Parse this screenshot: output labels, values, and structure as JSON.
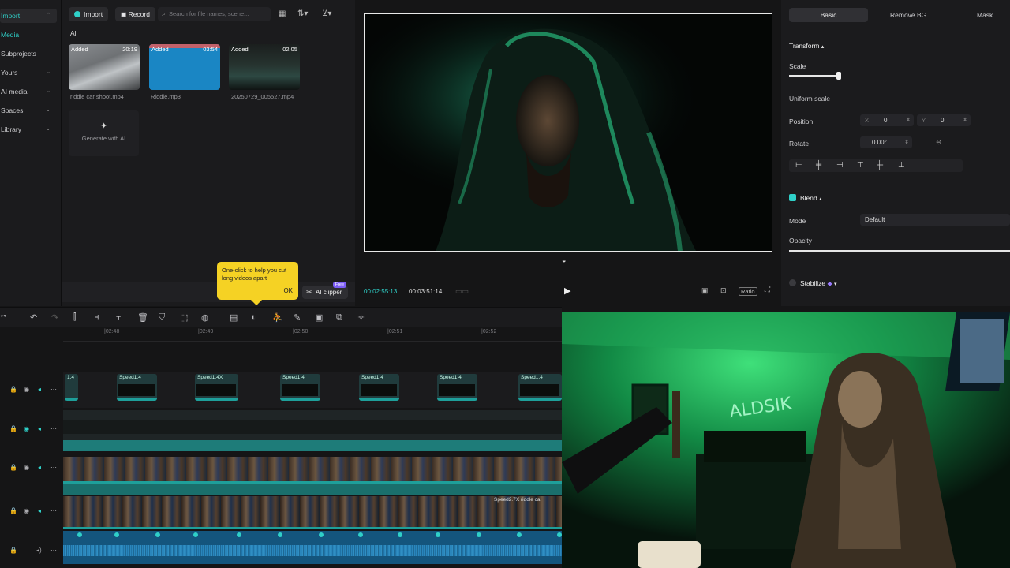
{
  "nav": {
    "items": [
      {
        "label": "Import",
        "active": true,
        "chevron": "⌃"
      },
      {
        "label": "Media",
        "active": true
      },
      {
        "label": "Subprojects"
      },
      {
        "label": "Yours",
        "chevron": "⌄"
      },
      {
        "label": "AI media",
        "chevron": "⌄"
      },
      {
        "label": "Spaces",
        "chevron": "⌄"
      },
      {
        "label": "Library",
        "chevron": "⌄"
      }
    ]
  },
  "media": {
    "import_label": "Import",
    "record_label": "Record",
    "search_placeholder": "Search for file names, scene...",
    "filter_all": "All",
    "items": [
      {
        "tag": "Added",
        "duration": "20:19",
        "name": "riddle car shoot.mp4"
      },
      {
        "tag": "Added",
        "duration": "03:54",
        "name": "Riddle.mp3"
      },
      {
        "tag": "Added",
        "duration": "02:05",
        "name": "20250729_005527.mp4"
      }
    ],
    "generate_label": "Generate with AI",
    "tooltip_text": "One-click to help you cut long videos apart",
    "tooltip_ok": "OK",
    "ai_clipper_label": "AI clipper",
    "ai_clipper_badge": "Free"
  },
  "preview": {
    "current_time": "00:02:55:13",
    "total_time": "00:03:51:14",
    "ratio_label": "Ratio"
  },
  "inspector": {
    "tabs": [
      "Basic",
      "Remove BG",
      "Mask"
    ],
    "transform_label": "Transform",
    "scale_label": "Scale",
    "uniform_scale_label": "Uniform scale",
    "position_label": "Position",
    "pos_x_label": "X",
    "pos_x_value": "0",
    "pos_y_label": "Y",
    "pos_y_value": "0",
    "rotate_label": "Rotate",
    "rotate_value": "0.00°",
    "blend_label": "Blend",
    "mode_label": "Mode",
    "mode_value": "Default",
    "opacity_label": "Opacity",
    "stabilize_label": "Stabilize",
    "scale_level": 0.95,
    "opacity_level": 1.0
  },
  "timeline": {
    "ruler": [
      "|02:48",
      "|02:49",
      "|02:50",
      "|02:51",
      "|02:52"
    ],
    "speed_clips": [
      "Speed1.4",
      "Speed1.4",
      "Speed1.4X",
      "Speed1.4",
      "Speed1.4",
      "Speed1.4",
      "Speed1.4"
    ],
    "bottom_clip_label": "Speed2.7X  riddle ca"
  },
  "colors": {
    "accent": "#2fd0c8",
    "tooltip": "#f5d224",
    "clip_teal": "#1e9f9a"
  }
}
